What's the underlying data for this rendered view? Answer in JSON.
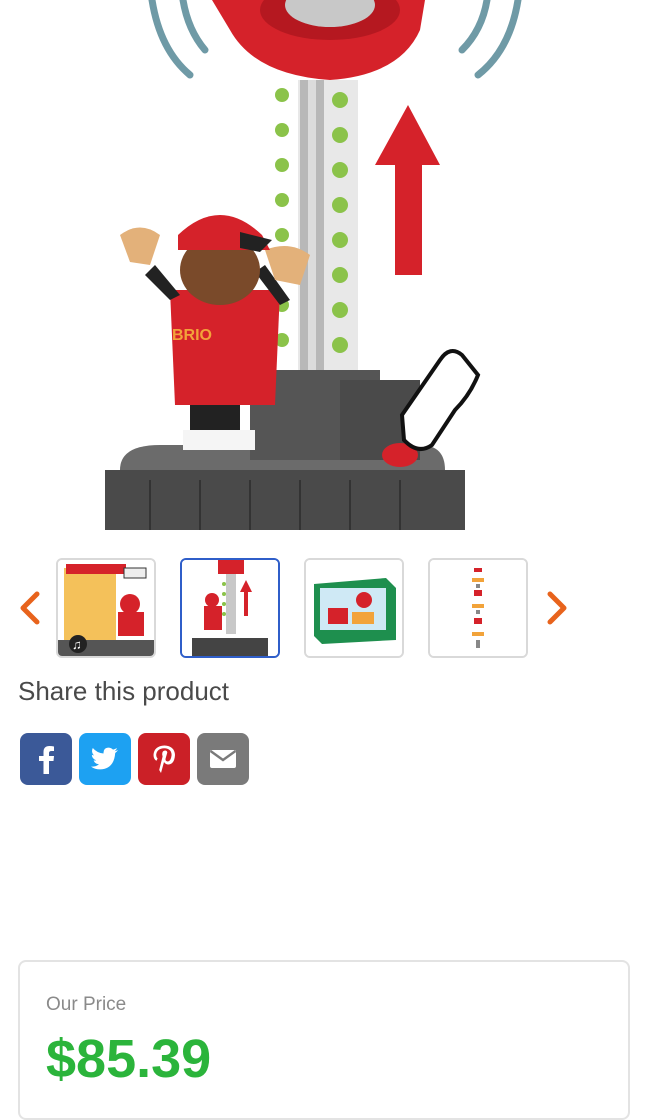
{
  "gallery": {
    "hero_image": "toy-high-striker-closeup",
    "thumbnails": [
      {
        "name": "thumb-product-1",
        "icon": "music-note-icon"
      },
      {
        "name": "thumb-product-2"
      },
      {
        "name": "thumb-product-3"
      },
      {
        "name": "thumb-product-4"
      }
    ],
    "prev_icon": "chevron-left-icon",
    "next_icon": "chevron-right-icon",
    "active_index": 1,
    "arrow_color": "#e8631c"
  },
  "share": {
    "title": "Share this product",
    "buttons": [
      {
        "name": "facebook",
        "icon": "facebook-icon",
        "color": "#3b5998"
      },
      {
        "name": "twitter",
        "icon": "twitter-icon",
        "color": "#1da1f2"
      },
      {
        "name": "pinterest",
        "icon": "pinterest-icon",
        "color": "#cb2027"
      },
      {
        "name": "email",
        "icon": "envelope-icon",
        "color": "#7a7a7a"
      }
    ]
  },
  "pricing": {
    "label": "Our Price",
    "value": "$85.39",
    "price_color": "#2bb43b"
  }
}
